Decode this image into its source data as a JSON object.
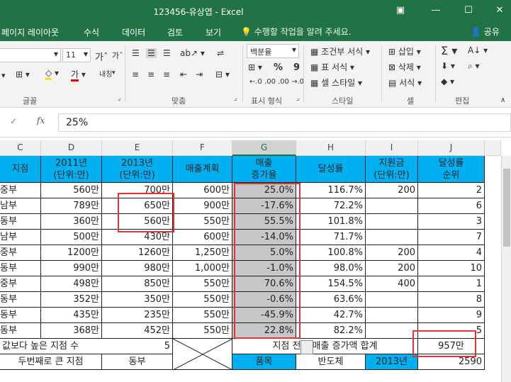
{
  "window": {
    "title": "123456-유상엽 - Excel",
    "controls": [
      "▣",
      "—",
      "☐",
      "✕"
    ]
  },
  "menu": {
    "tabs": [
      "페이지 레이아웃",
      "수식",
      "데이터",
      "검토",
      "보기"
    ],
    "tell_me": "수행할 작업을 알려 주세요.",
    "share": "공유"
  },
  "ribbon": {
    "font_name": "",
    "font_size": "11",
    "number_format": "백분율",
    "conditional_format": "조건부 서식",
    "table_format": "표 서식",
    "cell_style": "셀 스타일",
    "insert": "삽입",
    "delete": "삭제",
    "format": "서식",
    "groups": {
      "font": "글꼴",
      "alignment": "맞춤",
      "number": "표시 형식",
      "styles": "스타일",
      "cells": "셀",
      "editing": "편집"
    },
    "wrap_label": "내칭",
    "percent": "%",
    "comma": "9"
  },
  "formula_bar": {
    "value": "25%"
  },
  "columns": [
    "C",
    "D",
    "E",
    "F",
    "G",
    "H",
    "I",
    "J"
  ],
  "header_row": [
    "지점",
    "2011년\n(단위:만)",
    "2013년\n(단위:만)",
    "매출계획",
    "매출\n증가율",
    "달성률",
    "지원금\n(단위:만)",
    "달성률\n순위"
  ],
  "rows": [
    [
      "중부",
      "560만",
      "700만",
      "600만",
      "25.0%",
      "116.7%",
      "200",
      "2"
    ],
    [
      "남부",
      "789만",
      "650만",
      "900만",
      "-17.6%",
      "72.2%",
      "",
      "6"
    ],
    [
      "동부",
      "360만",
      "560만",
      "550만",
      "55.5%",
      "101.8%",
      "",
      "3"
    ],
    [
      "남부",
      "500만",
      "430만",
      "600만",
      "-14.0%",
      "71.7%",
      "",
      "7"
    ],
    [
      "중부",
      "1200만",
      "1260만",
      "1,250만",
      "5.0%",
      "100.8%",
      "200",
      "4"
    ],
    [
      "동부",
      "990만",
      "980만",
      "1,000만",
      "-1.0%",
      "98.0%",
      "200",
      "10"
    ],
    [
      "중부",
      "498만",
      "850만",
      "550만",
      "70.6%",
      "154.5%",
      "400",
      "1"
    ],
    [
      "동부",
      "352만",
      "350만",
      "550만",
      "-0.6%",
      "63.6%",
      "",
      "8"
    ],
    [
      "동부",
      "435만",
      "235만",
      "550만",
      "-45.9%",
      "42.7%",
      "",
      "9"
    ],
    [
      "동부",
      "368만",
      "452만",
      "550만",
      "22.8%",
      "82.2%",
      "",
      "5"
    ]
  ],
  "summary1": {
    "label": "값보다 높은 지점 수",
    "value": "5",
    "total_label": "지점 전체 매출 증가액 합계",
    "total_value": "957만"
  },
  "summary2": {
    "label": "두번째로 큰 지점",
    "value": "동부",
    "item_label": "품목",
    "item_value": "반도체",
    "year_label": "2013년",
    "year_value": "2590"
  },
  "colors": {
    "excel_green": "#217346",
    "header_blue": "#00b0f0",
    "selected_gray": "#c7c7c7",
    "annotation_red": "#e53333"
  }
}
